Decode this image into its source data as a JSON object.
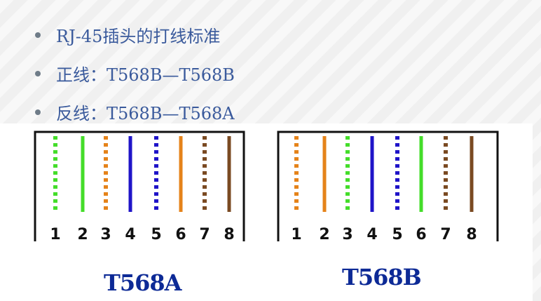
{
  "bullets": [
    "RJ-45插头的打线标准",
    "正线：T568B—T568B",
    "反线：T568B—T568A"
  ],
  "colors": {
    "green": "#44dd2a",
    "orange": "#e5831a",
    "blue": "#1f14c8",
    "brown": "#7a4a22",
    "bullet_text": "#3a5a9c",
    "label": "#0d2a96"
  },
  "diagrams": [
    {
      "label": "T568A",
      "pins": [
        "1",
        "2",
        "3",
        "4",
        "5",
        "6",
        "7",
        "8"
      ],
      "wires": [
        {
          "color": "green",
          "style": "striped"
        },
        {
          "color": "green",
          "style": "solid"
        },
        {
          "color": "orange",
          "style": "striped"
        },
        {
          "color": "blue",
          "style": "solid"
        },
        {
          "color": "blue",
          "style": "striped"
        },
        {
          "color": "orange",
          "style": "solid"
        },
        {
          "color": "brown",
          "style": "striped"
        },
        {
          "color": "brown",
          "style": "solid"
        }
      ]
    },
    {
      "label": "T568B",
      "pins": [
        "1",
        "2",
        "3",
        "4",
        "5",
        "6",
        "7",
        "8"
      ],
      "wires": [
        {
          "color": "orange",
          "style": "striped"
        },
        {
          "color": "orange",
          "style": "solid"
        },
        {
          "color": "green",
          "style": "striped"
        },
        {
          "color": "blue",
          "style": "solid"
        },
        {
          "color": "blue",
          "style": "striped"
        },
        {
          "color": "green",
          "style": "solid"
        },
        {
          "color": "brown",
          "style": "striped"
        },
        {
          "color": "brown",
          "style": "solid"
        }
      ]
    }
  ]
}
